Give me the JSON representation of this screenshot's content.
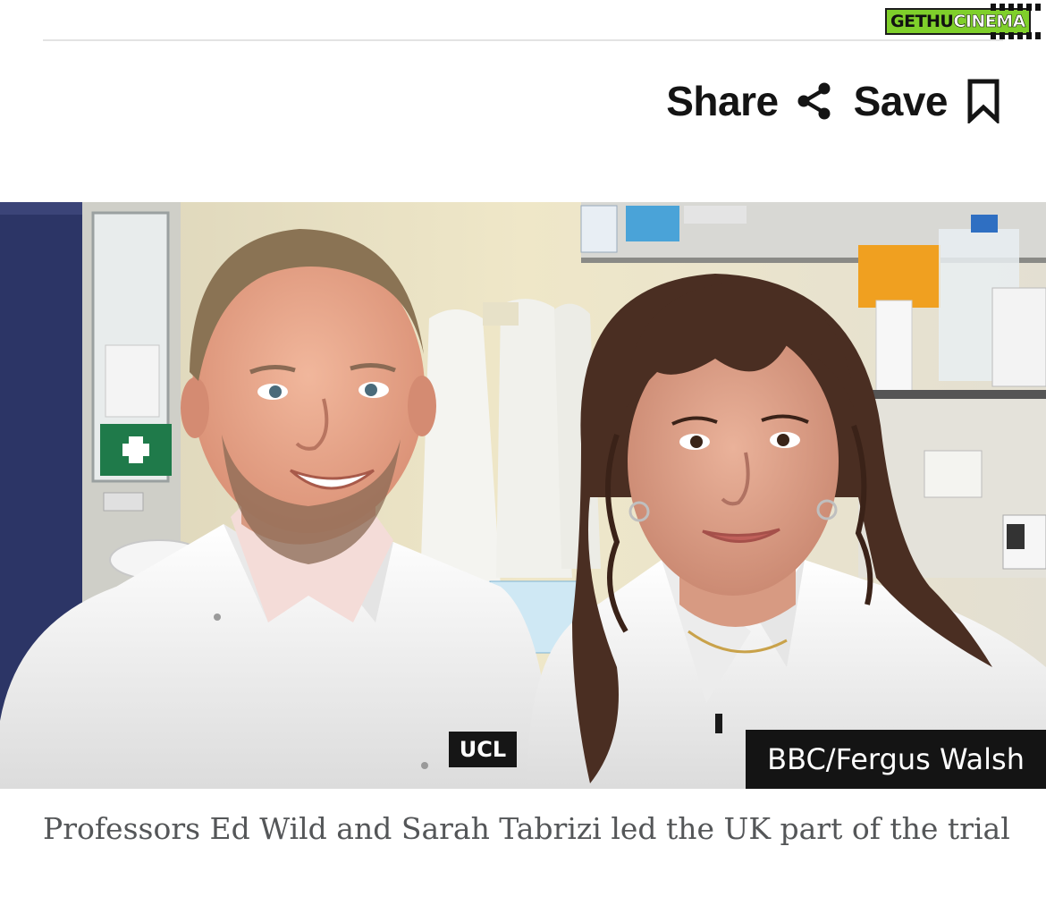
{
  "watermark": {
    "part1": "GETHU",
    "part2": "CINEMA"
  },
  "toolbar": {
    "share_label": "Share",
    "save_label": "Save",
    "share_icon": "share-icon",
    "save_icon": "bookmark-icon"
  },
  "image": {
    "credit": "BBC/Fergus Walsh",
    "coat_logo": "UCL"
  },
  "caption": "Professors Ed Wild and Sarah Tabrizi led the UK part of the trial",
  "colors": {
    "text": "#141414",
    "caption": "#545658",
    "credit_bg": "#141414",
    "watermark_green": "#7fcf2b"
  }
}
